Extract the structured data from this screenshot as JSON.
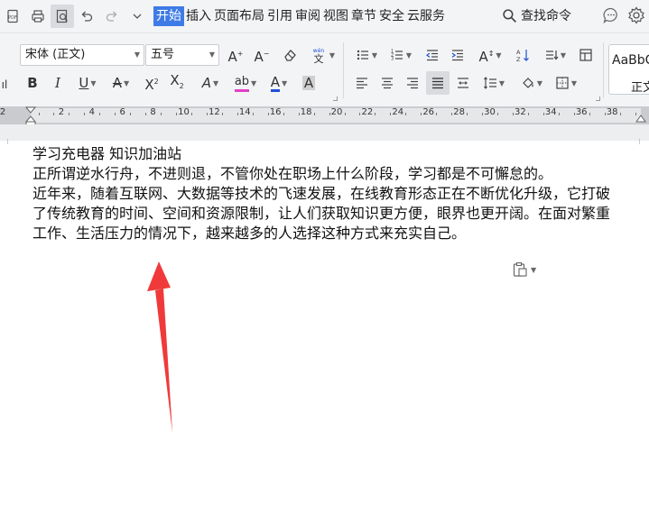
{
  "menubar": {
    "tabs": [
      {
        "label": "开始",
        "active": true
      },
      {
        "label": "插入"
      },
      {
        "label": "页面布局"
      },
      {
        "label": "引用"
      },
      {
        "label": "审阅"
      },
      {
        "label": "视图"
      },
      {
        "label": "章节"
      },
      {
        "label": "安全"
      },
      {
        "label": "云服务"
      }
    ],
    "search_label": "查找命令"
  },
  "ribbon": {
    "font_name": "宋体 (正文)",
    "font_size": "五号",
    "style_preview": "AaBbC",
    "style_name": "正文",
    "accent_colors": {
      "highlight": "#e040c8",
      "font_color": "#1f4fd8",
      "active_tab": "#3f7be6"
    }
  },
  "ruler": {
    "labels": [
      "2",
      "2",
      "4",
      "6",
      "8",
      "10",
      "12",
      "14",
      "16",
      "18",
      "20",
      "22",
      "24",
      "26",
      "28",
      "30",
      "32",
      "34",
      "36",
      "38"
    ]
  },
  "document": {
    "paragraphs": [
      "学习充电器 知识加油站",
      "正所谓逆水行舟，不进则退，不管你处在职场上什么阶段，学习都是不可懈怠的。",
      "近年来，随着互联网、大数据等技术的飞速发展，在线教育形态正在不断优化升级，它打破",
      "了传统教育的时间、空间和资源限制，让人们获取知识更方便，眼界也更开阔。在面对繁重",
      "工作、生活压力的情况下，越来越多的人选择这种方式来充实自己。"
    ]
  },
  "annotation": {
    "arrow_color": "#f03a3a"
  }
}
